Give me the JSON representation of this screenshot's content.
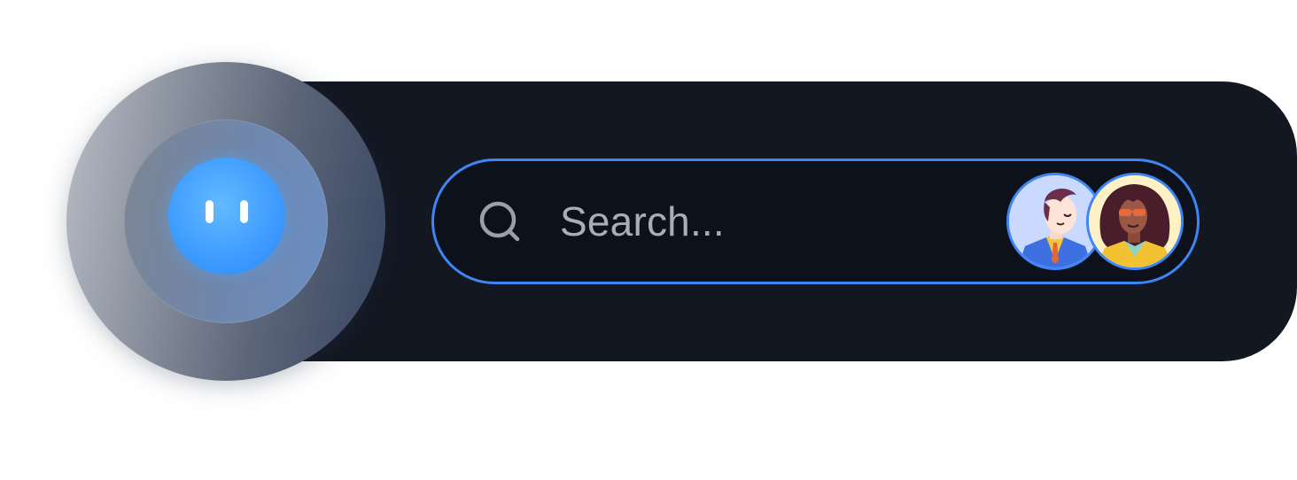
{
  "search": {
    "placeholder": "Search..."
  },
  "icons": {
    "search": "search-icon",
    "assistant": "assistant-orb-icon"
  },
  "avatars": [
    {
      "name": "avatar-man-suit"
    },
    {
      "name": "avatar-woman-sunglasses"
    }
  ],
  "colors": {
    "bar_background": "#131722",
    "search_border": "#3f86f5",
    "orb_core": "#3d9bff",
    "placeholder_text": "#a8adb6"
  }
}
